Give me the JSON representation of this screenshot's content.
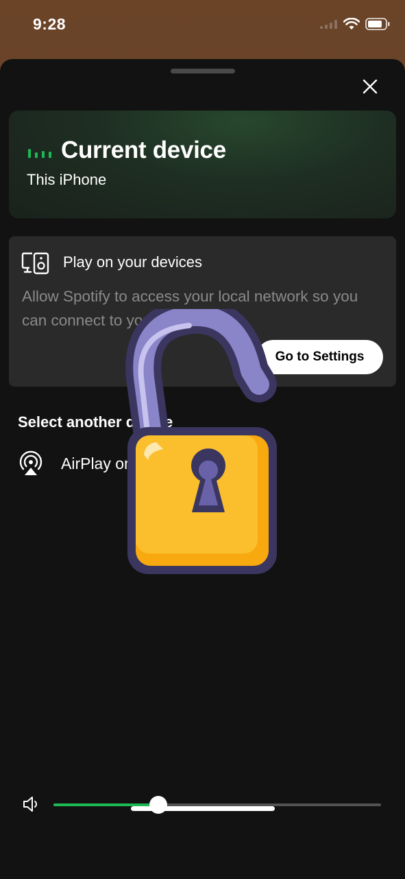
{
  "status": {
    "time": "9:28"
  },
  "current_device": {
    "title": "Current device",
    "name": "This iPhone"
  },
  "play_card": {
    "title": "Play on your devices",
    "description": "Allow Spotify to access your local network so you can connect to your devices.",
    "button_label": "Go to Settings"
  },
  "select_heading": "Select another device",
  "airplay": {
    "label": "AirPlay or Bluetooth"
  },
  "volume": {
    "level": 0.32
  },
  "colors": {
    "accent": "#1db954",
    "sheet": "#121212",
    "card": "#2a2a2a",
    "lock_body": "#fbb829",
    "lock_outline": "#3b3660"
  }
}
